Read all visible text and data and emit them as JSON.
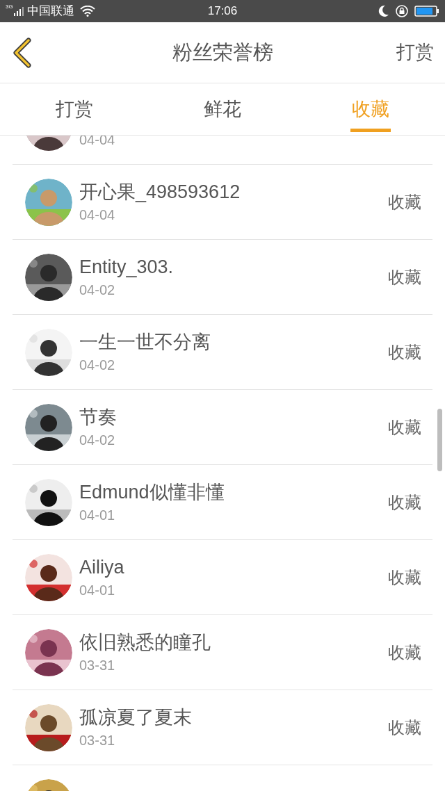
{
  "status_bar": {
    "network": "3G",
    "carrier": "中国联通",
    "time": "17:06"
  },
  "header": {
    "title": "粉丝荣誉榜",
    "action": "打赏"
  },
  "tabs": [
    {
      "label": "打赏",
      "selected": false
    },
    {
      "label": "鲜花",
      "selected": false
    },
    {
      "label": "收藏",
      "selected": true
    }
  ],
  "list": [
    {
      "date": "04-04"
    },
    {
      "name": "开心果_498593612",
      "date": "04-04",
      "action": "收藏"
    },
    {
      "name": "Entity_303.",
      "date": "04-02",
      "action": "收藏"
    },
    {
      "name": "一生一世不分离",
      "date": "04-02",
      "action": "收藏"
    },
    {
      "name": "节奏",
      "date": "04-02",
      "action": "收藏"
    },
    {
      "name": "Edmund似懂非懂",
      "date": "04-01",
      "action": "收藏"
    },
    {
      "name": "Ailiya",
      "date": "04-01",
      "action": "收藏"
    },
    {
      "name": "依旧熟悉的瞳孔",
      "date": "03-31",
      "action": "收藏"
    },
    {
      "name": "孤凉夏了夏末",
      "date": "03-31",
      "action": "收藏"
    }
  ]
}
